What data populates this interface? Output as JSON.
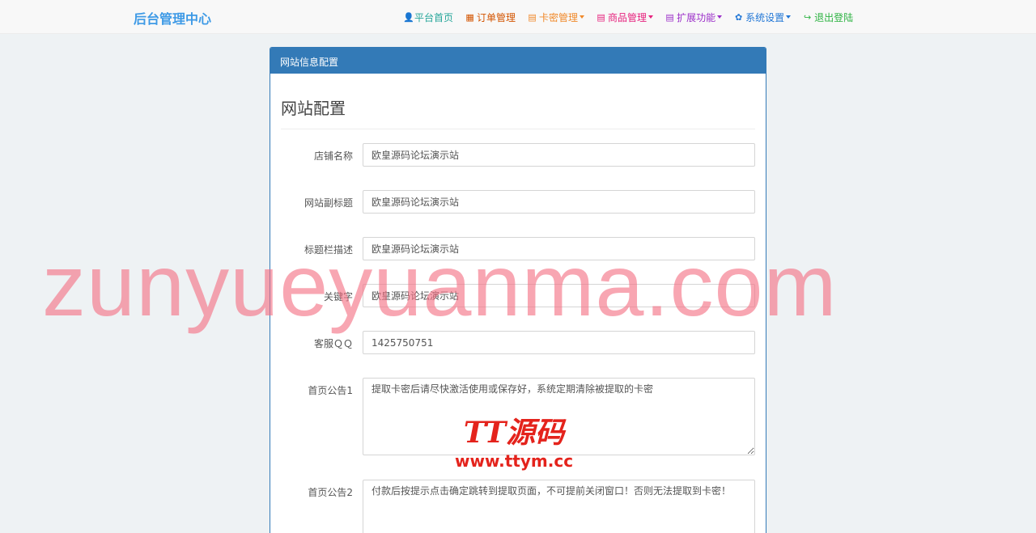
{
  "brand": "后台管理中心",
  "nav": [
    {
      "label": "平台首页",
      "icon": "👤",
      "color": "#26a69a",
      "dropdown": false
    },
    {
      "label": "订单管理",
      "icon": "▦",
      "color": "#d35400",
      "dropdown": false
    },
    {
      "label": "卡密管理",
      "icon": "▤",
      "color": "#f0892a",
      "dropdown": true
    },
    {
      "label": "商品管理",
      "icon": "▤",
      "color": "#e6227d",
      "dropdown": true
    },
    {
      "label": "扩展功能",
      "icon": "▤",
      "color": "#9b2fc9",
      "dropdown": true
    },
    {
      "label": "系统设置",
      "icon": "✿",
      "color": "#2277d6",
      "dropdown": true
    },
    {
      "label": "退出登陆",
      "icon": "↪",
      "color": "#2fb344",
      "dropdown": false
    }
  ],
  "panel": {
    "heading": "网站信息配置",
    "section_title": "网站配置"
  },
  "form": {
    "shop_name": {
      "label": "店铺名称",
      "value": "欧皇源码论坛演示站"
    },
    "subtitle": {
      "label": "网站副标题",
      "value": "欧皇源码论坛演示站"
    },
    "title_desc": {
      "label": "标题栏描述",
      "value": "欧皇源码论坛演示站"
    },
    "keywords": {
      "label": "关键字",
      "value": "欧皇源码论坛演示站"
    },
    "qq": {
      "label": "客服ＱＱ",
      "value": "1425750751"
    },
    "notice1": {
      "label": "首页公告1",
      "value": "提取卡密后请尽快激活使用或保存好，系统定期清除被提取的卡密"
    },
    "notice2": {
      "label": "首页公告2",
      "value": "付款后按提示点击确定跳转到提取页面，不可提前关闭窗口！否则无法提取到卡密！"
    }
  },
  "watermark": {
    "text": "zunyueyuanma.com",
    "logo": "TT源码",
    "url": "www.ttym.cc"
  }
}
